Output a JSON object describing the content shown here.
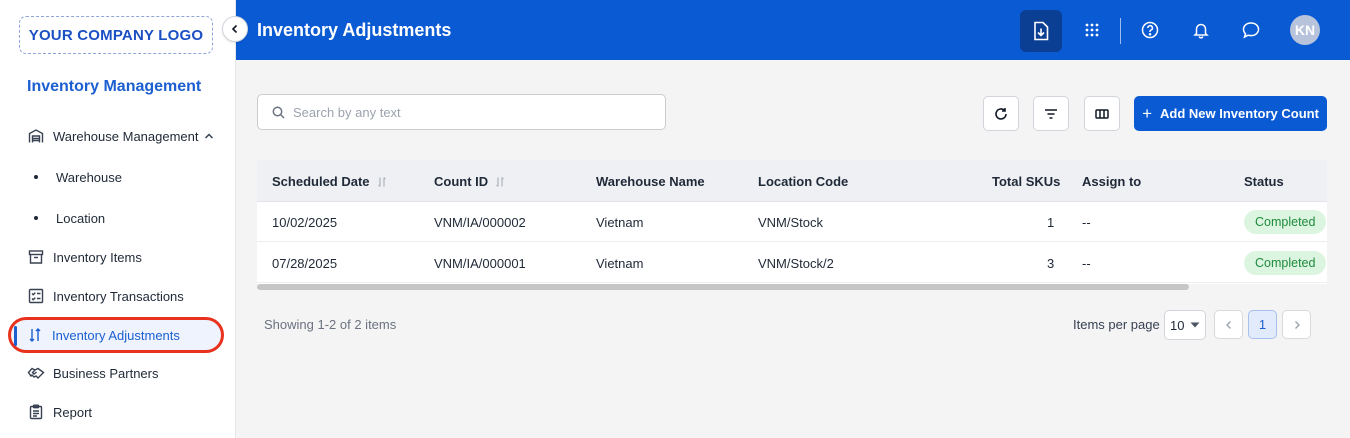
{
  "sidebar": {
    "logo": "YOUR COMPANY LOGO",
    "section_title": "Inventory Management",
    "items": [
      {
        "label": "Warehouse Management",
        "icon": "warehouse-icon"
      },
      {
        "label": "Warehouse"
      },
      {
        "label": "Location"
      },
      {
        "label": "Inventory Items",
        "icon": "archive-box-icon"
      },
      {
        "label": "Inventory Transactions",
        "icon": "checklist-icon"
      },
      {
        "label": "Inventory Adjustments",
        "icon": "adjust-arrows-icon",
        "active": true
      },
      {
        "label": "Business Partners",
        "icon": "handshake-icon"
      },
      {
        "label": "Report",
        "icon": "report-icon"
      }
    ]
  },
  "header": {
    "title": "Inventory Adjustments",
    "avatar_initials": "KN",
    "icons": [
      "download-icon",
      "apps-grid-icon",
      "help-icon",
      "bell-icon",
      "chat-icon"
    ]
  },
  "toolbar": {
    "search_placeholder": "Search by any text",
    "add_button_label": "Add New Inventory Count"
  },
  "table": {
    "columns": [
      "Scheduled Date",
      "Count ID",
      "Warehouse Name",
      "Location Code",
      "Total SKUs",
      "Assign to",
      "Status"
    ],
    "rows": [
      {
        "scheduled_date": "10/02/2025",
        "count_id": "VNM/IA/000002",
        "warehouse_name": "Vietnam",
        "location_code": "VNM/Stock",
        "total_skus": "1",
        "assign_to": "--",
        "status": "Completed"
      },
      {
        "scheduled_date": "07/28/2025",
        "count_id": "VNM/IA/000001",
        "warehouse_name": "Vietnam",
        "location_code": "VNM/Stock/2",
        "total_skus": "3",
        "assign_to": "--",
        "status": "Completed"
      }
    ]
  },
  "footer": {
    "showing_text": "Showing 1-2 of 2 items",
    "items_per_page_label": "Items per page",
    "items_per_page_value": "10",
    "current_page": "1"
  },
  "colors": {
    "primary": "#0a5ad4",
    "status_completed_bg": "#dcf5e1",
    "status_completed_text": "#1e8b3b",
    "highlight_ring": "#e8321e"
  }
}
